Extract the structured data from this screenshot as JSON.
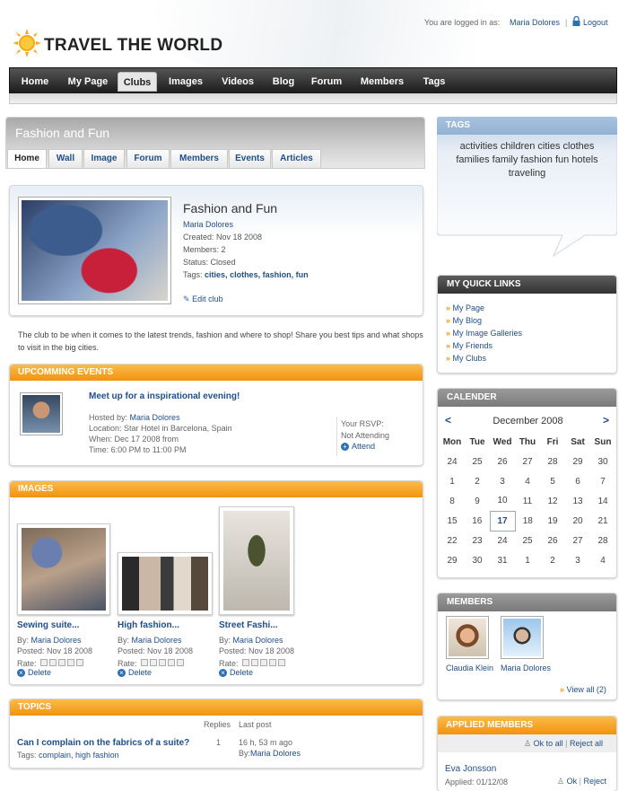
{
  "header": {
    "logo": "TRAVEL THE WORLD",
    "logged_prefix": "You are logged in as:",
    "user": "Maria Dolores",
    "logout": "Logout"
  },
  "nav": [
    "Home",
    "My Page",
    "Clubs",
    "Images",
    "Videos",
    "Blog",
    "Forum",
    "Members",
    "Tags"
  ],
  "club": {
    "title": "Fashion and Fun",
    "tabs": [
      "Home",
      "Wall",
      "Image",
      "Forum",
      "Members",
      "Events",
      "Articles"
    ],
    "name": "Fashion and Fun",
    "owner": "Maria Dolores",
    "created": "Created: Nov 18 2008",
    "members": "Members: 2",
    "status": "Status: Closed",
    "tags_label": "Tags:",
    "tags": [
      "cities,",
      "clothes,",
      "fashion,",
      "fun"
    ],
    "edit": "Edit club",
    "description": "The club to be when it comes to the latest trends, fashion and where to shop! Share you best tips and what shops to visit in the big cities."
  },
  "events": {
    "title": "UPCOMMING EVENTS",
    "event_title": "Meet up for a inspirational evening!",
    "hosted_prefix": "Hosted by:",
    "host": "Maria Dolores",
    "location": "Location: Star Hotel in Barcelona, Spain",
    "when": "When: Dec 17 2008 from",
    "time": "Time: 6:00 PM to 11:00 PM",
    "rsvp_label": "Your RSVP:",
    "rsvp_status": "Not Attending",
    "attend": "Attend"
  },
  "images": {
    "title": "IMAGES",
    "items": [
      {
        "title": "Sewing suite...",
        "by_prefix": "By:",
        "by": "Maria Dolores",
        "posted": "Posted: Nov 18 2008",
        "rate": "Rate:",
        "delete": "Delete"
      },
      {
        "title": "High fashion...",
        "by_prefix": "By:",
        "by": "Maria Dolores",
        "posted": "Posted: Nov 18 2008",
        "rate": "Rate:",
        "delete": "Delete"
      },
      {
        "title": "Street Fashi...",
        "by_prefix": "By:",
        "by": "Maria Dolores",
        "posted": "Posted: Nov 18 2008",
        "rate": "Rate:",
        "delete": "Delete"
      }
    ]
  },
  "topics": {
    "title": "TOPICS",
    "col_replies": "Replies",
    "col_last": "Last post",
    "topic_title": "Can I complain on the fabrics of a suite?",
    "tags_label": "Tags:",
    "tags": "complain, high fashion",
    "replies": "1",
    "last_time": "16 h, 53 m ago",
    "last_by_prefix": "By:",
    "last_by": "Maria Dolores"
  },
  "tags_box": {
    "title": "TAGS",
    "text": "activities children cities clothes families family fashion fun hotels traveling"
  },
  "quicklinks": {
    "title": "MY QUICK LINKS",
    "items": [
      "My Page",
      "My Blog",
      "My Image Galleries",
      "My Friends",
      "My Clubs"
    ]
  },
  "calendar": {
    "title": "CALENDER",
    "prev": "<",
    "month": "December 2008",
    "next": ">",
    "days": [
      "Mon",
      "Tue",
      "Wed",
      "Thu",
      "Fri",
      "Sat",
      "Sun"
    ],
    "weeks": [
      [
        "24",
        "25",
        "26",
        "27",
        "28",
        "29",
        "30"
      ],
      [
        "1",
        "2",
        "3",
        "4",
        "5",
        "6",
        "7"
      ],
      [
        "8",
        "9",
        "10",
        "11",
        "12",
        "13",
        "14"
      ],
      [
        "15",
        "16",
        "17",
        "18",
        "19",
        "20",
        "21"
      ],
      [
        "22",
        "23",
        "24",
        "25",
        "26",
        "27",
        "28"
      ],
      [
        "29",
        "30",
        "31",
        "1",
        "2",
        "3",
        "4"
      ]
    ],
    "today": "17"
  },
  "members_box": {
    "title": "MEMBERS",
    "members": [
      "Claudia Klein",
      "Maria Dolores"
    ],
    "view_all": "View all (2)"
  },
  "applied": {
    "title": "APPLIED MEMBERS",
    "ok_all": "Ok to all",
    "reject_all": "Reject all",
    "name": "Eva Jonsson",
    "applied": "Applied: 01/12/08",
    "ok": "Ok",
    "reject": "Reject"
  }
}
